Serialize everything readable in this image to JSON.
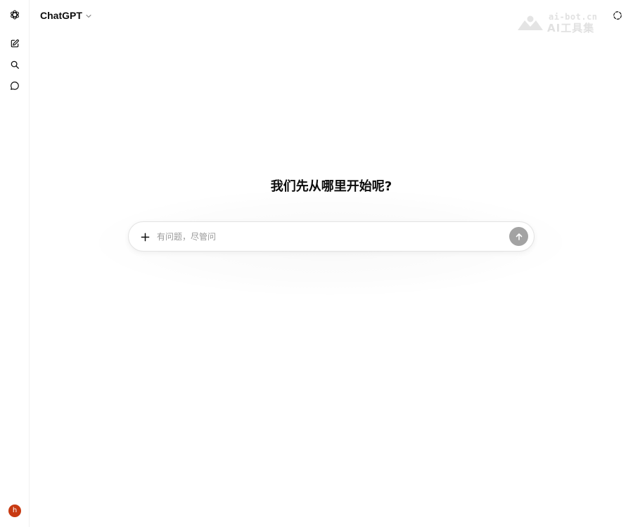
{
  "header": {
    "model_name": "ChatGPT"
  },
  "watermark": {
    "domain": "ai-bot.cn",
    "name": "AI工具集"
  },
  "sidebar": {
    "user_initial": "h"
  },
  "main": {
    "heading": "我们先从哪里开始呢?"
  },
  "composer": {
    "placeholder": "有问题，尽管问",
    "value": ""
  },
  "colors": {
    "avatar_bg": "#c83a12",
    "send_button_disabled": "#a3a3a3",
    "text": "#0d0d0d"
  },
  "icons": {
    "logo": "openai-logo-icon",
    "new_chat": "new-chat-icon",
    "search": "search-icon",
    "chats": "chat-bubble-icon",
    "temporary_chat": "dashed-circle-icon",
    "model_dropdown": "chevron-down-icon",
    "add": "plus-icon",
    "send": "arrow-up-icon"
  }
}
